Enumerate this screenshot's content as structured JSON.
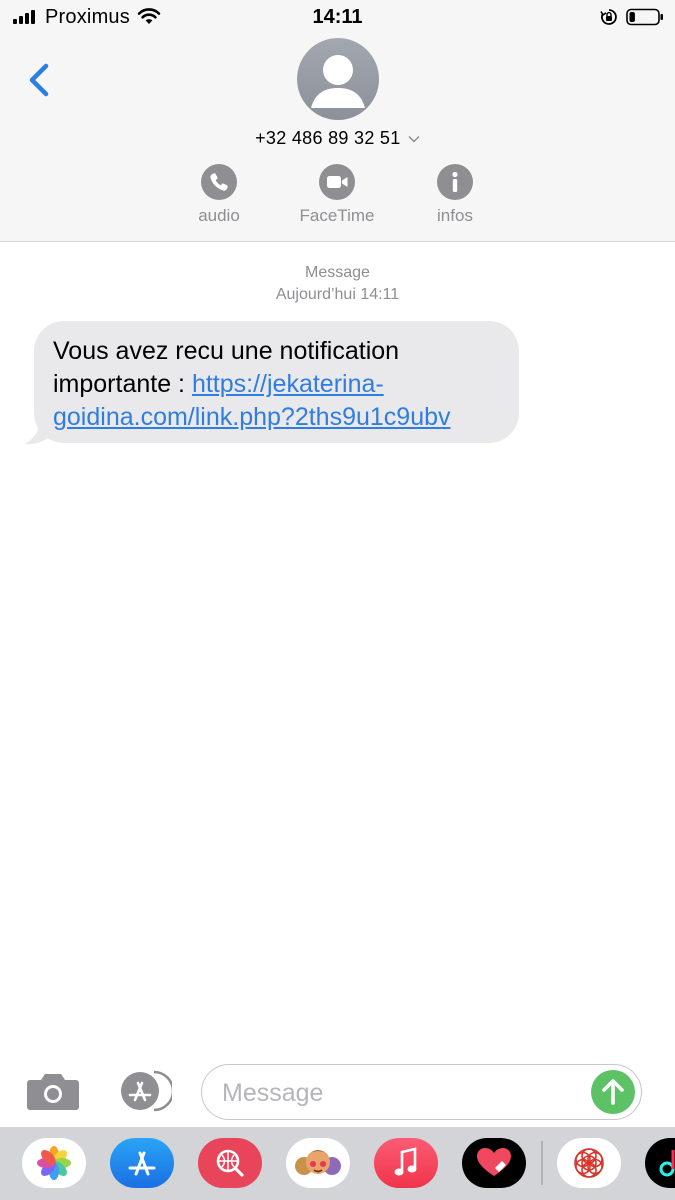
{
  "status_bar": {
    "carrier": "Proximus",
    "time": "14:11",
    "signal_bars": 4,
    "battery_level": 0.2
  },
  "header": {
    "contact": "+32 486 89 32 51",
    "actions": [
      {
        "id": "audio",
        "label": "audio",
        "icon": "phone-icon"
      },
      {
        "id": "facetime",
        "label": "FaceTime",
        "icon": "video-camera-icon"
      },
      {
        "id": "infos",
        "label": "infos",
        "icon": "info-icon"
      }
    ]
  },
  "conversation": {
    "service": "Message",
    "date": "Aujourd’hui 14:11",
    "messages": [
      {
        "direction": "incoming",
        "line1": "Vous avez recu une notification",
        "line2_text": "importante : ",
        "link_part1": "https://jekaterina-",
        "link_part2": "goidina.com/link.php?2ths9u1c9ubv"
      }
    ]
  },
  "composer": {
    "placeholder": "Message",
    "value": ""
  },
  "app_drawer": {
    "apps": [
      "photos-app-icon",
      "app-store-app-icon",
      "search-images-app-icon",
      "memoji-app-icon",
      "music-app-icon",
      "digital-touch-app-icon",
      "flower-app-icon",
      "tiktok-app-icon"
    ]
  },
  "colors": {
    "accent_blue": "#2f7de1",
    "send_green": "#5dc266",
    "bubble_gray": "#e9e9eb",
    "secondary_text": "#8e8e93",
    "header_bg": "#f6f6f6"
  }
}
